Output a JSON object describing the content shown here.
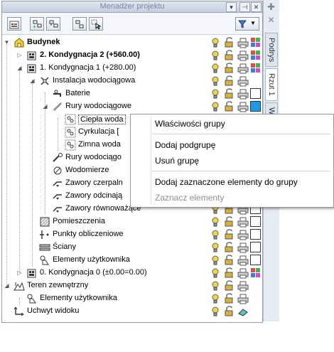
{
  "window": {
    "title": "Menadżer projektu",
    "pin_glyph": "⊕",
    "close_glyph": "✕"
  },
  "toolbar": {
    "filter_dropdown_glyph": "▼"
  },
  "side_tabs": [
    {
      "label": "Podrys",
      "active": false
    },
    {
      "label": "Rzut 1",
      "active": true
    },
    {
      "label": "W",
      "active": false
    }
  ],
  "tree": [
    {
      "label": "Budynek",
      "bold": true,
      "level": 0,
      "expander": "▼",
      "icon": "building-icon"
    },
    {
      "label": "2. Kondygnacja 2 (+560.00)",
      "bold": true,
      "level": 1,
      "expander": "▷",
      "icon": "floor-icon"
    },
    {
      "label": "1. Kondygnacja 1 (+280.00)",
      "bold": false,
      "level": 1,
      "expander": "◢",
      "icon": "floor-icon"
    },
    {
      "label": "Instalacja wodociągowa",
      "bold": false,
      "level": 2,
      "expander": "◢",
      "icon": "water-installation-icon"
    },
    {
      "label": "Baterie",
      "bold": false,
      "level": 3,
      "expander": "",
      "icon": "tap-icon"
    },
    {
      "label": "Rury wodociągowe",
      "bold": false,
      "level": 3,
      "expander": "◢",
      "icon": "pipe-icon"
    },
    {
      "label": "Ciepła woda",
      "bold": false,
      "level": 4,
      "expander": "",
      "icon": "group-icon",
      "selected": true
    },
    {
      "label": "Cyrkulacja [",
      "bold": false,
      "level": 4,
      "expander": "",
      "icon": "group-icon"
    },
    {
      "label": "Zimna woda",
      "bold": false,
      "level": 4,
      "expander": "",
      "icon": "group-icon"
    },
    {
      "label": "Rury wodociągo",
      "bold": false,
      "level": 3,
      "expander": "",
      "icon": "pipe-group-icon"
    },
    {
      "label": "Wodomierze",
      "bold": false,
      "level": 3,
      "expander": "",
      "icon": "meter-icon"
    },
    {
      "label": "Zawory czerpaln",
      "bold": false,
      "level": 3,
      "expander": "",
      "icon": "valve-icon"
    },
    {
      "label": "Zawory odcinają",
      "bold": false,
      "level": 3,
      "expander": "",
      "icon": "valve-icon"
    },
    {
      "label": "Zawory równoważące",
      "bold": false,
      "level": 3,
      "expander": "",
      "icon": "valve-icon"
    },
    {
      "label": "Pomieszczenia",
      "bold": false,
      "level": 2,
      "expander": "",
      "icon": "room-icon"
    },
    {
      "label": "Punkty obliczeniowe",
      "bold": false,
      "level": 2,
      "expander": "",
      "icon": "points-icon"
    },
    {
      "label": "Ściany",
      "bold": false,
      "level": 2,
      "expander": "",
      "icon": "wall-icon"
    },
    {
      "label": "Elementy użytkownika",
      "bold": false,
      "level": 2,
      "expander": "",
      "icon": "user-elements-icon"
    },
    {
      "label": "0. Kondygnacja 0 (±0.00=0.00)",
      "bold": false,
      "level": 1,
      "expander": "▷",
      "icon": "floor-icon"
    },
    {
      "label": "Teren zewnętrzny",
      "bold": false,
      "level": 0,
      "expander": "◢",
      "icon": "terrain-icon"
    },
    {
      "label": "Elementy użytkownika",
      "bold": false,
      "level": 1,
      "expander": "",
      "icon": "user-elements-icon"
    },
    {
      "label": "Uchwyt widoku",
      "bold": false,
      "level": 0,
      "expander": "",
      "icon": "view-handle-icon"
    }
  ],
  "row_colors": [
    "multi",
    "multi",
    "multi",
    "none",
    "empty",
    "#1e9be6",
    "none",
    "none",
    "none",
    "empty",
    "empty",
    "empty",
    "empty",
    "empty",
    "empty",
    "empty",
    "empty",
    "empty",
    "multi",
    "none",
    "none",
    "none"
  ],
  "context_menu": {
    "items": [
      {
        "label": "Właściwości grupy",
        "disabled": false
      },
      {
        "label": "Dodaj podgrupę",
        "disabled": false
      },
      {
        "label": "Usuń grupę",
        "disabled": false
      },
      {
        "label": "Dodaj zaznaczone elementy do grupy",
        "disabled": false
      },
      {
        "label": "Zaznacz elementy",
        "disabled": true
      }
    ]
  },
  "colors": {
    "accent": "#1e9be6",
    "bulb": "#e8d84a",
    "lock": "#d8b23a"
  }
}
